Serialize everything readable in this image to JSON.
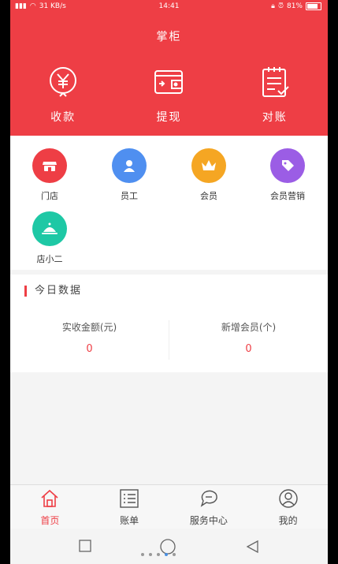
{
  "status": {
    "signal": "31 KB/s",
    "time": "14:41",
    "battery": "81%"
  },
  "header": {
    "title": "掌柜"
  },
  "top_actions": [
    {
      "label": "收款",
      "icon": "yuan-icon"
    },
    {
      "label": "提现",
      "icon": "wallet-icon"
    },
    {
      "label": "对账",
      "icon": "clipboard-check-icon"
    }
  ],
  "grid": [
    {
      "label": "门店",
      "icon": "store-icon",
      "color": "#ee3e45"
    },
    {
      "label": "员工",
      "icon": "user-icon",
      "color": "#4f8ff0"
    },
    {
      "label": "会员",
      "icon": "crown-icon",
      "color": "#f5a623"
    },
    {
      "label": "会员营销",
      "icon": "tag-icon",
      "color": "#9b5de5"
    },
    {
      "label": "店小二",
      "icon": "cloche-icon",
      "color": "#1ec8a5"
    }
  ],
  "stats": {
    "title": "今日数据",
    "items": [
      {
        "label": "实收金额(元)",
        "value": "0"
      },
      {
        "label": "新增会员(个)",
        "value": "0"
      }
    ]
  },
  "tabs": [
    {
      "label": "首页",
      "icon": "home-icon",
      "active": true
    },
    {
      "label": "账单",
      "icon": "list-icon"
    },
    {
      "label": "服务中心",
      "icon": "chat-icon"
    },
    {
      "label": "我的",
      "icon": "profile-icon"
    }
  ],
  "colors": {
    "primary": "#ee3e45"
  }
}
